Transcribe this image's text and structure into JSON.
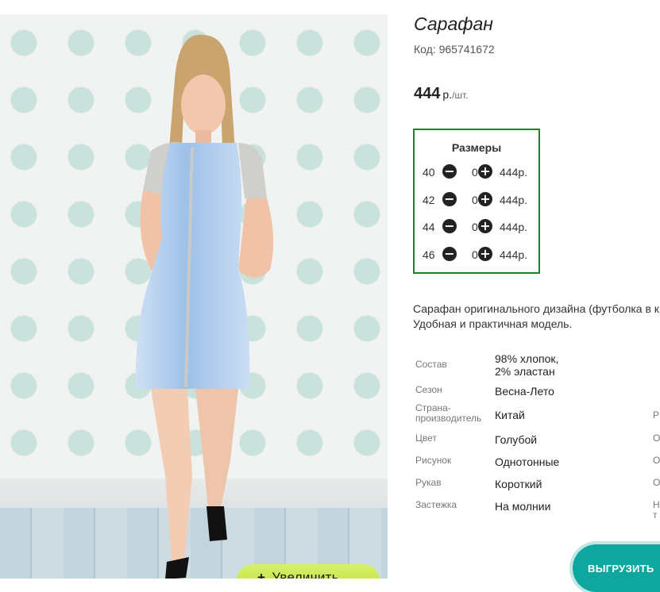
{
  "gallery": {
    "zoom_label": "Увеличить"
  },
  "product": {
    "title": "Сарафан",
    "code": "Код: 965741672",
    "price": "444",
    "currency": "р.",
    "unit": "/шт."
  },
  "sizes": {
    "title": "Размеры",
    "rows": [
      {
        "size": "40",
        "qty": "0",
        "price": "444р."
      },
      {
        "size": "42",
        "qty": "0",
        "price": "444р."
      },
      {
        "size": "44",
        "qty": "0",
        "price": "444р."
      },
      {
        "size": "46",
        "qty": "0",
        "price": "444р."
      }
    ]
  },
  "description": {
    "line1": "Сарафан оригинального дизайна (футболка в к",
    "line2": "Удобная и практичная модель."
  },
  "properties": [
    {
      "label": "Состав",
      "value": "98% хлопок, 2% эластан",
      "extra": ""
    },
    {
      "label": "Сезон",
      "value": "Весна-Лето",
      "extra": ""
    },
    {
      "label": "Страна-производитель",
      "value": "Китай",
      "extra": "Р"
    },
    {
      "label": "Цвет",
      "value": "Голубой",
      "extra": "О"
    },
    {
      "label": "Рисунок",
      "value": "Однотонные",
      "extra": "О"
    },
    {
      "label": "Рукав",
      "value": "Короткий",
      "extra": "О"
    },
    {
      "label": "Застежка",
      "value": "На молнии",
      "extra": "Н т"
    }
  ],
  "actions": {
    "export_label": "ВЫГРУЗИТЬ"
  },
  "icons": {
    "minus": "minus-circle-icon",
    "plus": "plus-circle-icon",
    "zoom": "plus-icon"
  },
  "colors": {
    "sizes_border": "#0f8a1c",
    "zoom_button": "#c6e84a",
    "export_button": "#0fa6a0"
  }
}
